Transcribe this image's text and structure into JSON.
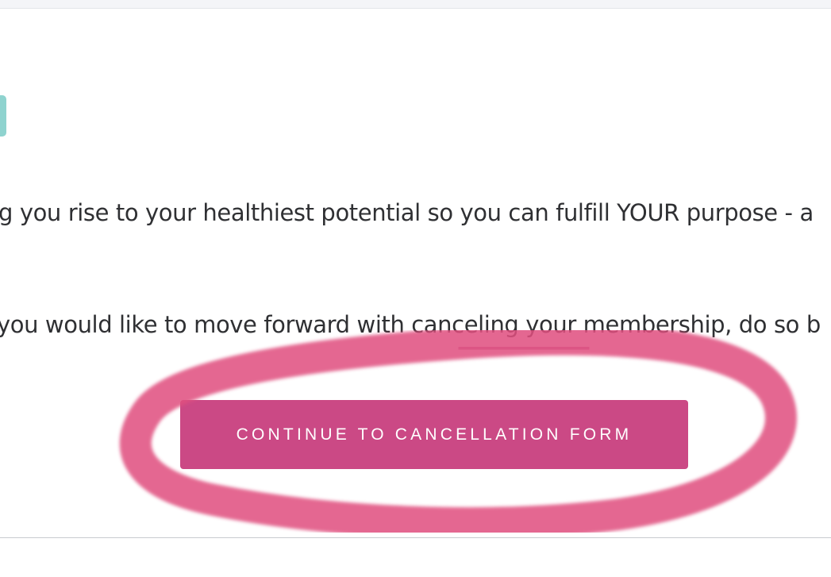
{
  "content": {
    "paragraph_1": "g you rise to your healthiest potential so you can fulfill YOUR purpose - a",
    "paragraph_2": "you would like to move forward with canceling your membership, do so b"
  },
  "cta": {
    "label": "CONTINUE TO CANCELLATION FORM"
  },
  "colors": {
    "button": "#cb4985",
    "highlight_marker": "#e0507f",
    "teal_accent": "#8fd3cf",
    "text": "#2f3033"
  }
}
